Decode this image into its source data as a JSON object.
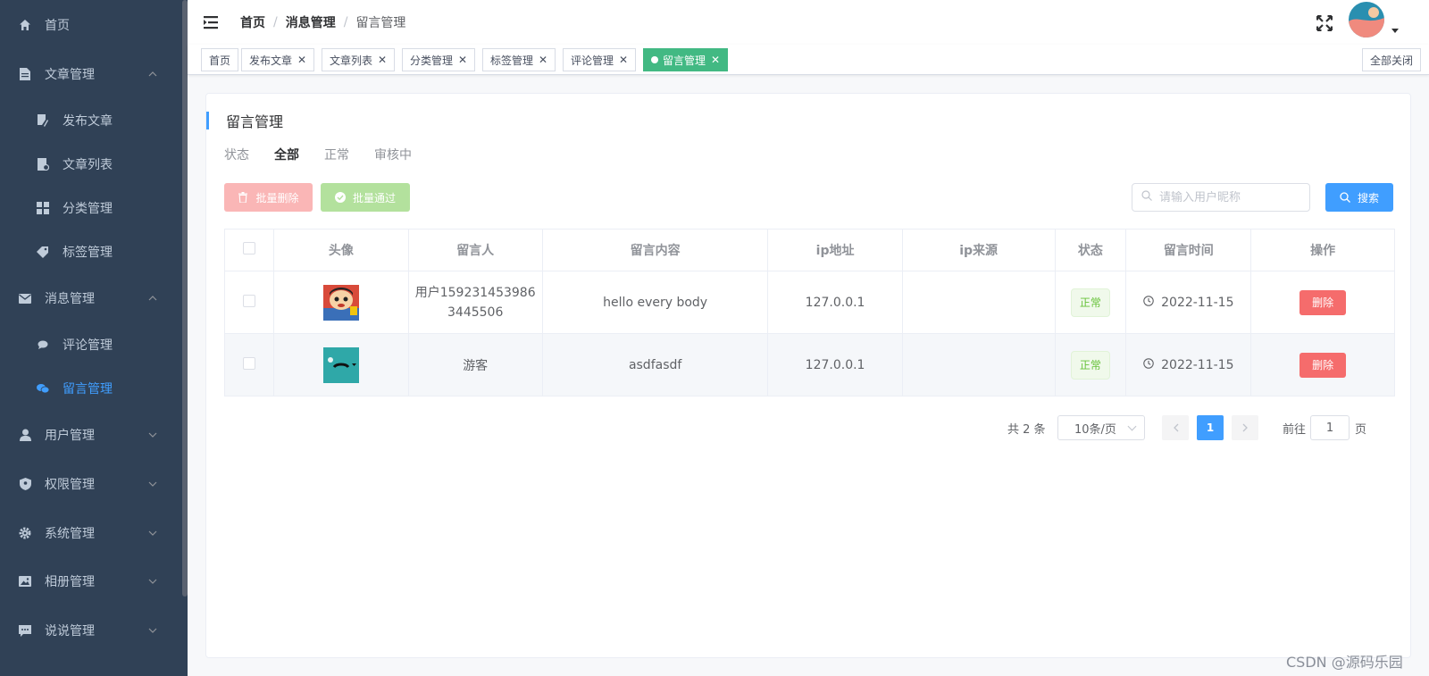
{
  "sidebar": {
    "items": [
      {
        "label": "首页",
        "icon": "home-icon"
      },
      {
        "label": "文章管理",
        "icon": "document-icon",
        "expanded": true
      },
      {
        "label": "发布文章",
        "icon": "edit-icon"
      },
      {
        "label": "文章列表",
        "icon": "file-list-icon"
      },
      {
        "label": "分类管理",
        "icon": "grid-icon"
      },
      {
        "label": "标签管理",
        "icon": "tag-icon"
      },
      {
        "label": "消息管理",
        "icon": "message-icon",
        "expanded": true
      },
      {
        "label": "评论管理",
        "icon": "comment-icon"
      },
      {
        "label": "留言管理",
        "icon": "chat-icon",
        "active": true
      },
      {
        "label": "用户管理",
        "icon": "user-icon"
      },
      {
        "label": "权限管理",
        "icon": "shield-icon"
      },
      {
        "label": "系统管理",
        "icon": "gear-icon"
      },
      {
        "label": "相册管理",
        "icon": "picture-icon"
      },
      {
        "label": "说说管理",
        "icon": "talk-icon"
      }
    ]
  },
  "navbar": {
    "breadcrumb": [
      "首页",
      "消息管理",
      "留言管理"
    ],
    "separator": "/"
  },
  "tags": {
    "items": [
      "首页",
      "发布文章",
      "文章列表",
      "分类管理",
      "标签管理",
      "评论管理",
      "留言管理"
    ],
    "active": "留言管理",
    "close_all": "全部关闭"
  },
  "card": {
    "title": "留言管理",
    "status_label": "状态",
    "status_options": [
      "全部",
      "正常",
      "审核中"
    ],
    "status_selected": "全部",
    "batch_delete": "批量删除",
    "batch_pass": "批量通过",
    "search_placeholder": "请输入用户昵称",
    "search_button": "搜索"
  },
  "table": {
    "headers": [
      "头像",
      "留言人",
      "留言内容",
      "ip地址",
      "ip来源",
      "状态",
      "留言时间",
      "操作"
    ],
    "rows": [
      {
        "nickname": "用户159231453986 3445506",
        "content": "hello every body",
        "ip": "127.0.0.1",
        "ip_source": "",
        "status": "正常",
        "time": "2022-11-15",
        "action": "删除"
      },
      {
        "nickname": "游客",
        "content": "asdfasdf",
        "ip": "127.0.0.1",
        "ip_source": "",
        "status": "正常",
        "time": "2022-11-15",
        "action": "删除"
      }
    ]
  },
  "pagination": {
    "total": "共 2 条",
    "page_size": "10条/页",
    "current_page": "1",
    "goto_label": "前往",
    "goto_value": "1",
    "goto_suffix": "页"
  },
  "watermark": "CSDN @源码乐园",
  "colors": {
    "sidebar_bg": "#304156",
    "accent": "#409eff",
    "tag_active": "#42b983",
    "danger": "#f56c6c",
    "success": "#67c23a"
  }
}
